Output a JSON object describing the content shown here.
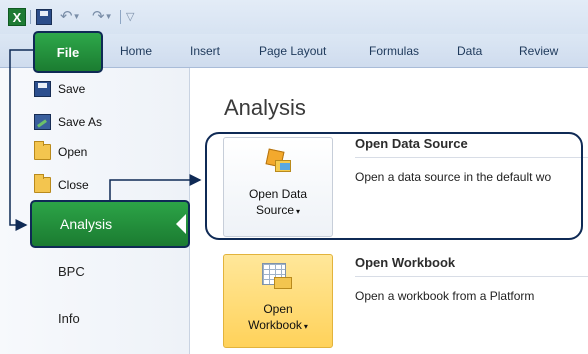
{
  "ribbon": {
    "file_tab": "File",
    "tabs": [
      "Home",
      "Insert",
      "Page Layout",
      "Formulas",
      "Data",
      "Review"
    ]
  },
  "nav": {
    "commands": [
      "Save",
      "Save As",
      "Open",
      "Close"
    ],
    "selected": "Analysis",
    "items": [
      "BPC",
      "Info"
    ]
  },
  "main": {
    "title": "Analysis",
    "actions": [
      {
        "button_line1": "Open Data",
        "button_line2": "Source",
        "title": "Open Data Source",
        "description": "Open a data source in the default wo"
      },
      {
        "button_line1": "Open",
        "button_line2": "Workbook",
        "title": "Open Workbook",
        "description": "Open a workbook from a Platform"
      }
    ]
  },
  "colors": {
    "accent_green": "#1b7c31",
    "annotation_navy": "#0f2a55",
    "highlight_yellow": "#ffd25a"
  }
}
